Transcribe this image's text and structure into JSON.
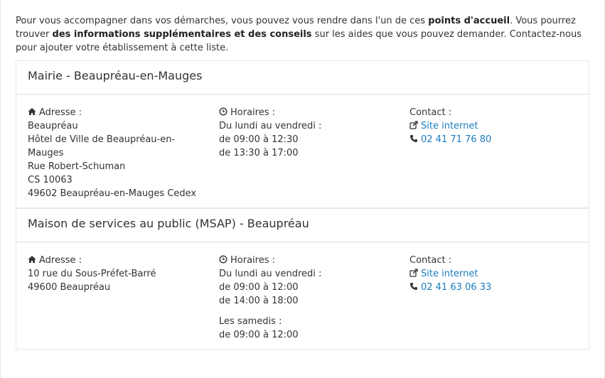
{
  "intro": {
    "part1": "Pour vous accompagner dans vos démarches, vous pouvez vous rendre dans l'un de ces ",
    "bold1": "points d'accueil",
    "part2": ". Vous pourrez trouver ",
    "bold2": "des informations supplémentaires et des conseils",
    "part3": " sur les aides que vous pouvez demander. Contactez-nous pour ajouter votre établissement à cette liste."
  },
  "labels": {
    "address": "Adresse :",
    "hours": "Horaires :",
    "contact": "Contact :",
    "website": "Site internet"
  },
  "locations": [
    {
      "name": "Mairie - Beaupréau-en-Mauges",
      "address": [
        "Beaupréau",
        "Hôtel de Ville de Beaupréau-en-",
        "Mauges",
        "Rue Robert-Schuman",
        "CS 10063",
        "49602 Beaupréau-en-Mauges Cedex"
      ],
      "schedule_day": "Du lundi au vendredi :",
      "schedule_slots": [
        "de 09:00 à 12:30",
        "de 13:30 à 17:00"
      ],
      "phone": "02 41 71 76 80"
    },
    {
      "name": "Maison de services au public (MSAP) - Beaupréau",
      "address": [
        "10 rue du Sous-Préfet-Barré",
        "49600 Beaupréau"
      ],
      "schedule_day": "Du lundi au vendredi :",
      "schedule_slots": [
        "de 09:00 à 12:00",
        "de 14:00 à 18:00"
      ],
      "schedule_day2": "Les samedis :",
      "schedule_slots2": [
        "de 09:00 à 12:00"
      ],
      "phone": "02 41 63 06 33"
    }
  ],
  "icons": {
    "address": "home-icon",
    "hours": "clock-icon",
    "website": "external-link-icon",
    "phone": "phone-icon"
  },
  "colors": {
    "link": "#1a7cbf"
  }
}
